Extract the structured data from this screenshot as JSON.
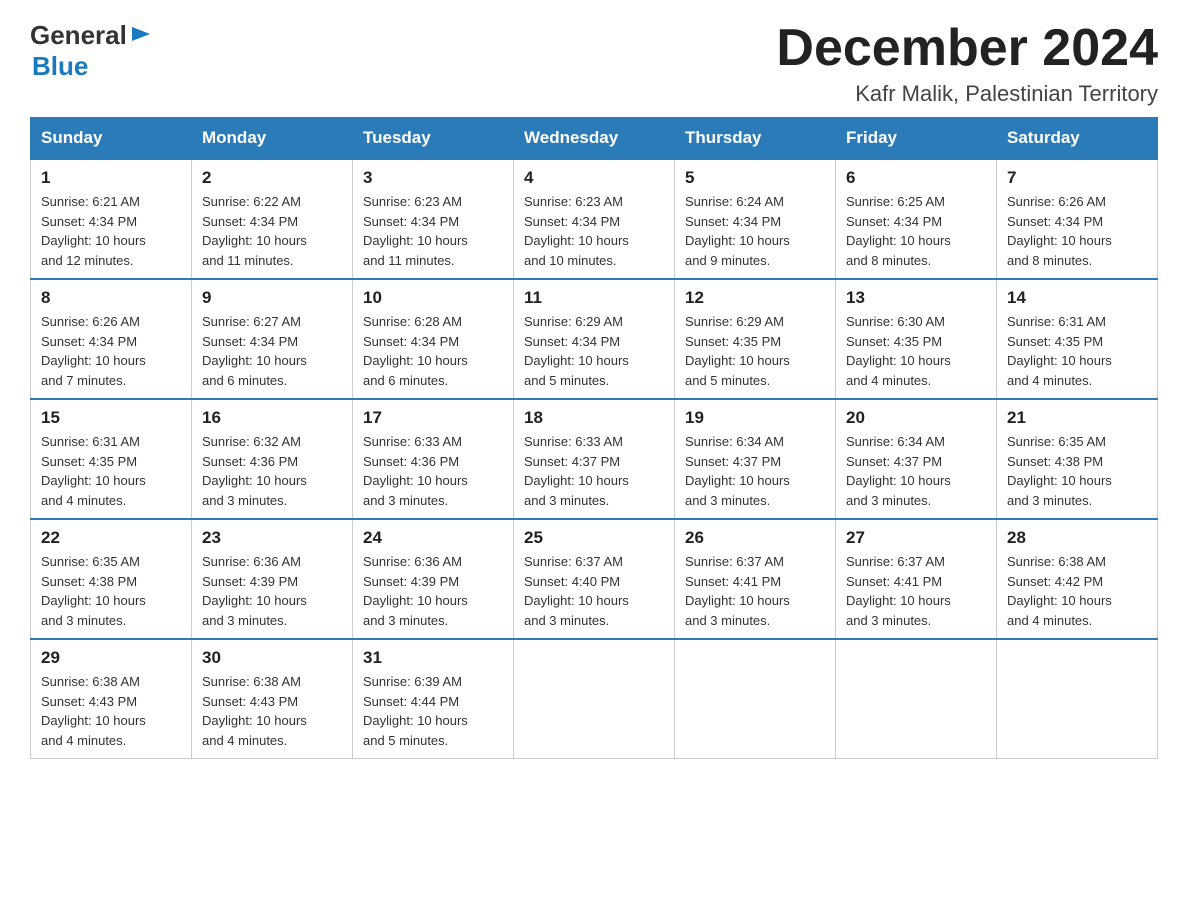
{
  "logo": {
    "general": "General",
    "blue": "Blue"
  },
  "header": {
    "month": "December 2024",
    "location": "Kafr Malik, Palestinian Territory"
  },
  "days_of_week": [
    "Sunday",
    "Monday",
    "Tuesday",
    "Wednesday",
    "Thursday",
    "Friday",
    "Saturday"
  ],
  "weeks": [
    [
      {
        "day": "1",
        "sunrise": "6:21 AM",
        "sunset": "4:34 PM",
        "daylight": "10 hours and 12 minutes."
      },
      {
        "day": "2",
        "sunrise": "6:22 AM",
        "sunset": "4:34 PM",
        "daylight": "10 hours and 11 minutes."
      },
      {
        "day": "3",
        "sunrise": "6:23 AM",
        "sunset": "4:34 PM",
        "daylight": "10 hours and 11 minutes."
      },
      {
        "day": "4",
        "sunrise": "6:23 AM",
        "sunset": "4:34 PM",
        "daylight": "10 hours and 10 minutes."
      },
      {
        "day": "5",
        "sunrise": "6:24 AM",
        "sunset": "4:34 PM",
        "daylight": "10 hours and 9 minutes."
      },
      {
        "day": "6",
        "sunrise": "6:25 AM",
        "sunset": "4:34 PM",
        "daylight": "10 hours and 8 minutes."
      },
      {
        "day": "7",
        "sunrise": "6:26 AM",
        "sunset": "4:34 PM",
        "daylight": "10 hours and 8 minutes."
      }
    ],
    [
      {
        "day": "8",
        "sunrise": "6:26 AM",
        "sunset": "4:34 PM",
        "daylight": "10 hours and 7 minutes."
      },
      {
        "day": "9",
        "sunrise": "6:27 AM",
        "sunset": "4:34 PM",
        "daylight": "10 hours and 6 minutes."
      },
      {
        "day": "10",
        "sunrise": "6:28 AM",
        "sunset": "4:34 PM",
        "daylight": "10 hours and 6 minutes."
      },
      {
        "day": "11",
        "sunrise": "6:29 AM",
        "sunset": "4:34 PM",
        "daylight": "10 hours and 5 minutes."
      },
      {
        "day": "12",
        "sunrise": "6:29 AM",
        "sunset": "4:35 PM",
        "daylight": "10 hours and 5 minutes."
      },
      {
        "day": "13",
        "sunrise": "6:30 AM",
        "sunset": "4:35 PM",
        "daylight": "10 hours and 4 minutes."
      },
      {
        "day": "14",
        "sunrise": "6:31 AM",
        "sunset": "4:35 PM",
        "daylight": "10 hours and 4 minutes."
      }
    ],
    [
      {
        "day": "15",
        "sunrise": "6:31 AM",
        "sunset": "4:35 PM",
        "daylight": "10 hours and 4 minutes."
      },
      {
        "day": "16",
        "sunrise": "6:32 AM",
        "sunset": "4:36 PM",
        "daylight": "10 hours and 3 minutes."
      },
      {
        "day": "17",
        "sunrise": "6:33 AM",
        "sunset": "4:36 PM",
        "daylight": "10 hours and 3 minutes."
      },
      {
        "day": "18",
        "sunrise": "6:33 AM",
        "sunset": "4:37 PM",
        "daylight": "10 hours and 3 minutes."
      },
      {
        "day": "19",
        "sunrise": "6:34 AM",
        "sunset": "4:37 PM",
        "daylight": "10 hours and 3 minutes."
      },
      {
        "day": "20",
        "sunrise": "6:34 AM",
        "sunset": "4:37 PM",
        "daylight": "10 hours and 3 minutes."
      },
      {
        "day": "21",
        "sunrise": "6:35 AM",
        "sunset": "4:38 PM",
        "daylight": "10 hours and 3 minutes."
      }
    ],
    [
      {
        "day": "22",
        "sunrise": "6:35 AM",
        "sunset": "4:38 PM",
        "daylight": "10 hours and 3 minutes."
      },
      {
        "day": "23",
        "sunrise": "6:36 AM",
        "sunset": "4:39 PM",
        "daylight": "10 hours and 3 minutes."
      },
      {
        "day": "24",
        "sunrise": "6:36 AM",
        "sunset": "4:39 PM",
        "daylight": "10 hours and 3 minutes."
      },
      {
        "day": "25",
        "sunrise": "6:37 AM",
        "sunset": "4:40 PM",
        "daylight": "10 hours and 3 minutes."
      },
      {
        "day": "26",
        "sunrise": "6:37 AM",
        "sunset": "4:41 PM",
        "daylight": "10 hours and 3 minutes."
      },
      {
        "day": "27",
        "sunrise": "6:37 AM",
        "sunset": "4:41 PM",
        "daylight": "10 hours and 3 minutes."
      },
      {
        "day": "28",
        "sunrise": "6:38 AM",
        "sunset": "4:42 PM",
        "daylight": "10 hours and 4 minutes."
      }
    ],
    [
      {
        "day": "29",
        "sunrise": "6:38 AM",
        "sunset": "4:43 PM",
        "daylight": "10 hours and 4 minutes."
      },
      {
        "day": "30",
        "sunrise": "6:38 AM",
        "sunset": "4:43 PM",
        "daylight": "10 hours and 4 minutes."
      },
      {
        "day": "31",
        "sunrise": "6:39 AM",
        "sunset": "4:44 PM",
        "daylight": "10 hours and 5 minutes."
      },
      null,
      null,
      null,
      null
    ]
  ],
  "labels": {
    "sunrise": "Sunrise:",
    "sunset": "Sunset:",
    "daylight": "Daylight:"
  }
}
